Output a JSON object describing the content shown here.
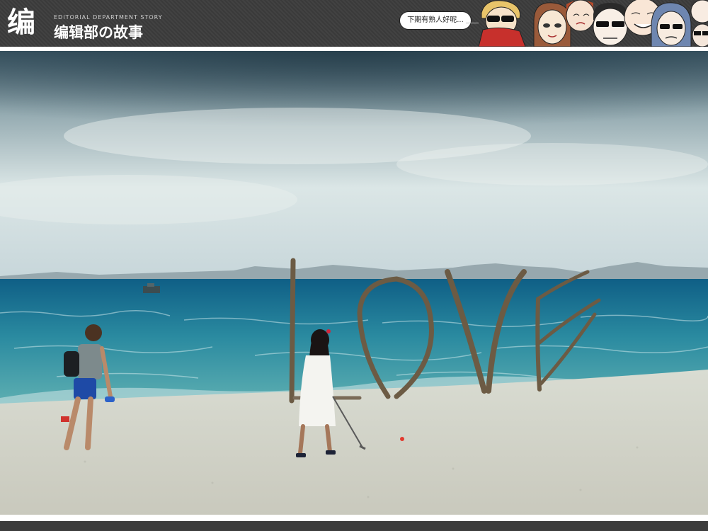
{
  "header": {
    "logo_glyph": "编",
    "logo_en": "EDITORIAL DEPARTMENT STORY",
    "logo_cn": "编辑部の故事",
    "bubble_text": "下期有熟人好呢...",
    "colors": {
      "bar": "#3c3c3c",
      "text": "#ffffff"
    }
  },
  "photo": {
    "description_icons": [
      "sea",
      "sky",
      "beach",
      "driftwood-love-sculpture",
      "man-with-backpack",
      "woman-in-white-dress",
      "boat"
    ],
    "sculpture_text": "LOVE"
  }
}
